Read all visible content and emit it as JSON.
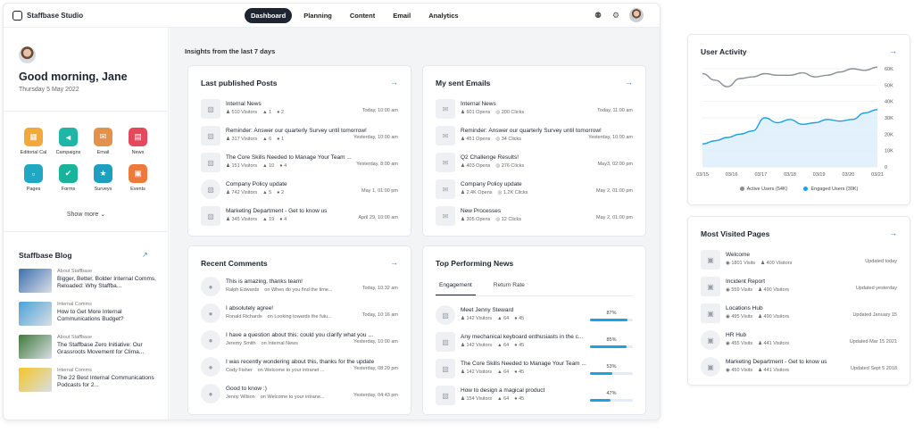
{
  "app": {
    "title": "Staffbase Studio"
  },
  "nav": [
    {
      "label": "Dashboard"
    },
    {
      "label": "Planning"
    },
    {
      "label": "Content"
    },
    {
      "label": "Email"
    },
    {
      "label": "Analytics"
    }
  ],
  "greeting": {
    "title": "Good morning, Jane",
    "date": "Thursday 5 May 2022"
  },
  "apps": [
    {
      "label": "Editorial Cal",
      "icon": "calendar-icon",
      "color": "#f2a83a"
    },
    {
      "label": "Campaigns",
      "icon": "megaphone-icon",
      "color": "#1fb6a8"
    },
    {
      "label": "Email",
      "icon": "mail-icon",
      "color": "#e2924a"
    },
    {
      "label": "News",
      "icon": "news-icon",
      "color": "#e5485b"
    },
    {
      "label": "Pages",
      "icon": "page-icon",
      "color": "#1fa7c4"
    },
    {
      "label": "Forms",
      "icon": "form-icon",
      "color": "#17b39a"
    },
    {
      "label": "Surveys",
      "icon": "survey-icon",
      "color": "#1d9fc0"
    },
    {
      "label": "Events",
      "icon": "event-icon",
      "color": "#ec7a3a"
    }
  ],
  "show_more": "Show more",
  "blog": {
    "title": "Staffbase Blog",
    "items": [
      {
        "category": "About Staffbase",
        "title": "Bigger, Better, Bolder Internal Comms, Reloaded: Why Staffba...",
        "color": "#3d6fb0"
      },
      {
        "category": "Internal Comms",
        "title": "How to Get More Internal Communications Budget?",
        "color": "#4aa3d8"
      },
      {
        "category": "About Staffbase",
        "title": "The Staffbase Zero Initiative: Our Grassroots Movement for Clima...",
        "color": "#3f7a3a"
      },
      {
        "category": "Internal Comms",
        "title": "The 22 Best Internal Communications Podcasts for 2...",
        "color": "#f3c623"
      }
    ]
  },
  "insights": "Insights from the last 7 days",
  "posts": {
    "title": "Last published Posts",
    "rows": [
      {
        "title": "Internal News",
        "visitors": "510 Visitors",
        "likes": "1",
        "comments": "2",
        "time": "Today, 10:00 am"
      },
      {
        "title": "Reminder: Answer our quarterly Survey until tomorrow!",
        "visitors": "317 Visitors",
        "likes": "6",
        "comments": "1",
        "time": "Yesterday, 10:00 am"
      },
      {
        "title": "The Core Skills Needed to Manage Your Team ...",
        "visitors": "151 Visitors",
        "likes": "10",
        "comments": "4",
        "time": "Yesterday, 8:00 am"
      },
      {
        "title": "Company Policy update",
        "visitors": "742 Visitors",
        "likes": "5",
        "comments": "2",
        "time": "May 1, 01:00 pm"
      },
      {
        "title": "Marketing Department - Get to know us",
        "visitors": "345 Visitors",
        "likes": "19",
        "comments": "4",
        "time": "April 29, 10:00 am"
      }
    ]
  },
  "emails": {
    "title": "My sent Emails",
    "rows": [
      {
        "title": "Internal News",
        "opens": "601 Opens",
        "clicks": "200 Clicks",
        "time": "Today, 11:00 am"
      },
      {
        "title": "Reminder: Answer our quarterly Survey until tomorrow!",
        "opens": "451 Opens",
        "clicks": "34 Clicks",
        "time": "Yesterday, 10:00 am"
      },
      {
        "title": "Q2 Challenge Results!",
        "opens": "403 Opens",
        "clicks": "276 Clicks",
        "time": "May3, 02:00 pm"
      },
      {
        "title": "Company Policy update",
        "opens": "2.4K Opens",
        "clicks": "1.2K Clicks",
        "time": "May 2, 01:00 pm"
      },
      {
        "title": "New Processes",
        "opens": "305 Opens",
        "clicks": "12 Clicks",
        "time": "May 2, 01:00 pm"
      }
    ]
  },
  "comments": {
    "title": "Recent Comments",
    "rows": [
      {
        "title": "This is amazing, thanks team!",
        "author": "Ralph Edwards",
        "context": "on When do you find the time...",
        "time": "Today, 10:32 am"
      },
      {
        "title": "I absolutely agree!",
        "author": "Ronald Richards",
        "context": "on Looking towards the futu...",
        "time": "Today, 10:16 am"
      },
      {
        "title": "I have a question about this: could you clarify what you mean...",
        "author": "Jeremy Smith",
        "context": "on Internal News",
        "time": "Yesterday, 10:00 am"
      },
      {
        "title": "I was recently wondering about this, thanks for the update",
        "author": "Cody Fisher",
        "context": "on Welcome to your intranet ...",
        "time": "Yesterday, 08:20 pm"
      },
      {
        "title": "Good to know :)",
        "author": "Jenny Wilson",
        "context": "on Welcome to your intrane...",
        "time": "Yesterday, 04:43 pm"
      }
    ]
  },
  "top_news": {
    "title": "Top Performing News",
    "tabs": [
      {
        "label": "Engagement"
      },
      {
        "label": "Return Rate"
      }
    ],
    "rows": [
      {
        "title": "Meet Jenny Steward",
        "visitors": "142 Visitors",
        "likes": "64",
        "comments": "45",
        "pct_label": "87%",
        "pct": 87
      },
      {
        "title": "Any mechanical keyboard enthusiasts in the c...",
        "visitors": "142 Visitors",
        "likes": "64",
        "comments": "45",
        "pct_label": "85%",
        "pct": 85
      },
      {
        "title": "The Core Skills Needed to Manage Your Team ...",
        "visitors": "142 Visitors",
        "likes": "64",
        "comments": "45",
        "pct_label": "53%",
        "pct": 53
      },
      {
        "title": "How to design a magical product",
        "visitors": "154 Visitors",
        "likes": "64",
        "comments": "45",
        "pct_label": "47%",
        "pct": 47
      }
    ]
  },
  "chart_data": {
    "type": "area",
    "title": "User Activity",
    "categories": [
      "03/15",
      "03/16",
      "03/17",
      "03/18",
      "03/19",
      "03/20",
      "03/21"
    ],
    "ylim": [
      0,
      60000
    ],
    "yticks": [
      "0",
      "10K",
      "20K",
      "30K",
      "40K",
      "50K",
      "60K"
    ],
    "grid": true,
    "legend": "bottom",
    "series": [
      {
        "name": "Active Users (54K)",
        "color": "#8a8f96",
        "values": [
          57000,
          53000,
          49000,
          54000,
          55000,
          57000,
          56000,
          56000,
          57500,
          55000,
          56000,
          58000,
          60000,
          59000,
          61000
        ]
      },
      {
        "name": "Engaged Users (30K)",
        "color": "#1aa1e6",
        "values": [
          14000,
          16000,
          18000,
          20000,
          22000,
          30000,
          27000,
          29000,
          26000,
          27000,
          29000,
          28000,
          29000,
          33000,
          35000
        ]
      }
    ]
  },
  "most_visited": {
    "title": "Most Visited Pages",
    "rows": [
      {
        "title": "Welcome",
        "visits": "1801 Visits",
        "visitors": "400 Visitors",
        "time": "Updated today"
      },
      {
        "title": "Incident Report",
        "visits": "559 Visits",
        "visitors": "490 Visitors",
        "time": "Updated yesterday"
      },
      {
        "title": "Locations Hub",
        "visits": "495 Visits",
        "visitors": "490 Visitors",
        "time": "Updated January 15"
      },
      {
        "title": "HR Hub",
        "visits": "455 Visits",
        "visitors": "441 Visitors",
        "time": "Updated Mar 15 2021"
      },
      {
        "title": "Marketing Department - Get to know us",
        "visits": "450 Visits",
        "visitors": "441 Visitors",
        "time": "Updated Sept 5 2018"
      }
    ]
  }
}
